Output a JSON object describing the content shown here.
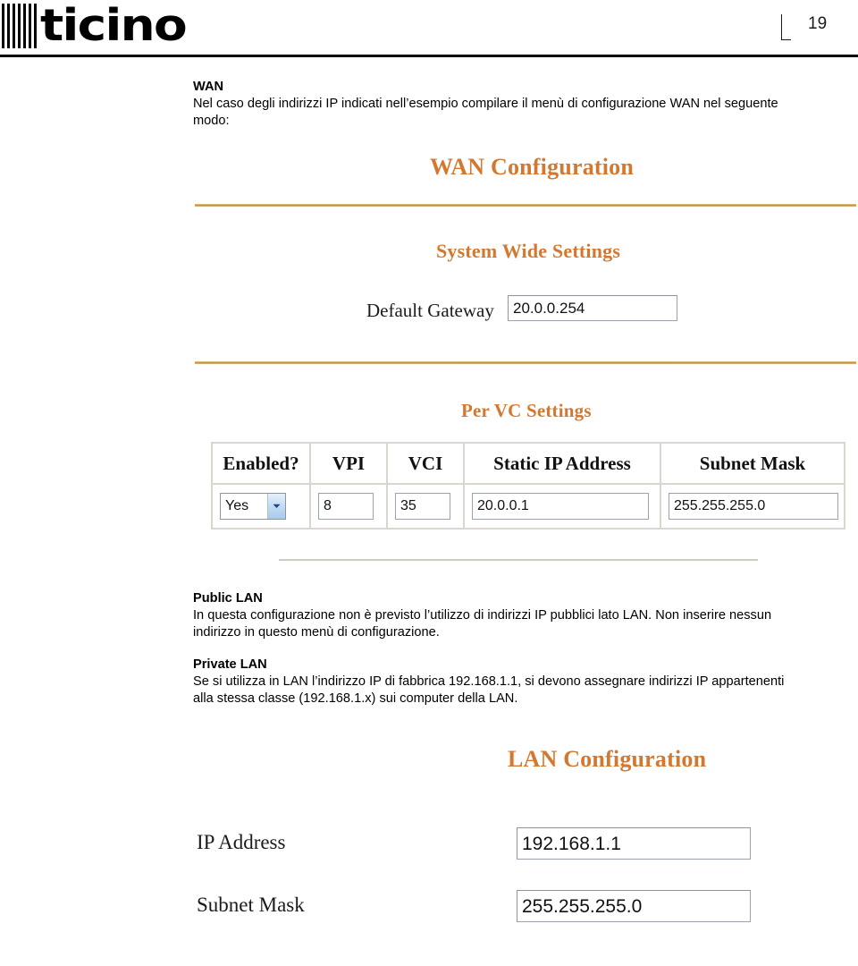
{
  "header": {
    "logo_text": "ticino",
    "logo_name": "bticino",
    "page_number": "19"
  },
  "intro": {
    "heading": "WAN",
    "line1": "Nel caso degli indirizzi IP indicati nell’esempio compilare il menù di configurazione WAN nel seguente",
    "line2": "modo:"
  },
  "wan_screenshot": {
    "title": "WAN Configuration",
    "system_wide_heading": "System Wide Settings",
    "default_gateway_label": "Default Gateway",
    "default_gateway_value": "20.0.0.254",
    "per_vc_heading": "Per VC Settings",
    "table": {
      "headers": [
        "Enabled?",
        "VPI",
        "VCI",
        "Static IP Address",
        "Subnet Mask"
      ],
      "row": {
        "enabled": "Yes",
        "vpi": "8",
        "vci": "35",
        "static_ip": "20.0.0.1",
        "subnet_mask": "255.255.255.0"
      }
    }
  },
  "lan_notes": {
    "public_heading": "Public LAN",
    "public_line1": "In questa configurazione non è previsto l’utilizzo di indirizzi IP pubblici lato LAN. Non inserire nessun",
    "public_line2": "indirizzo in questo menù di configurazione.",
    "private_heading": "Private LAN",
    "private_line1": "Se si utilizza in LAN l’indirizzo IP di fabbrica 192.168.1.1, si devono assegnare indirizzi IP appartenenti",
    "private_line2": "alla stessa classe (192.168.1.x) sui computer della LAN."
  },
  "lan_screenshot": {
    "title": "LAN Configuration",
    "ip_address_label": "IP Address",
    "ip_address_value": "192.168.1.1",
    "subnet_mask_label": "Subnet Mask",
    "subnet_mask_value": "255.255.255.0"
  },
  "colors": {
    "heading_orange": "#d4782f",
    "gold_rule": "#c89840",
    "rule_black": "#000000",
    "input_border": "#9aa3ab"
  },
  "icons": {
    "dropdown": "chevron-down-icon"
  }
}
